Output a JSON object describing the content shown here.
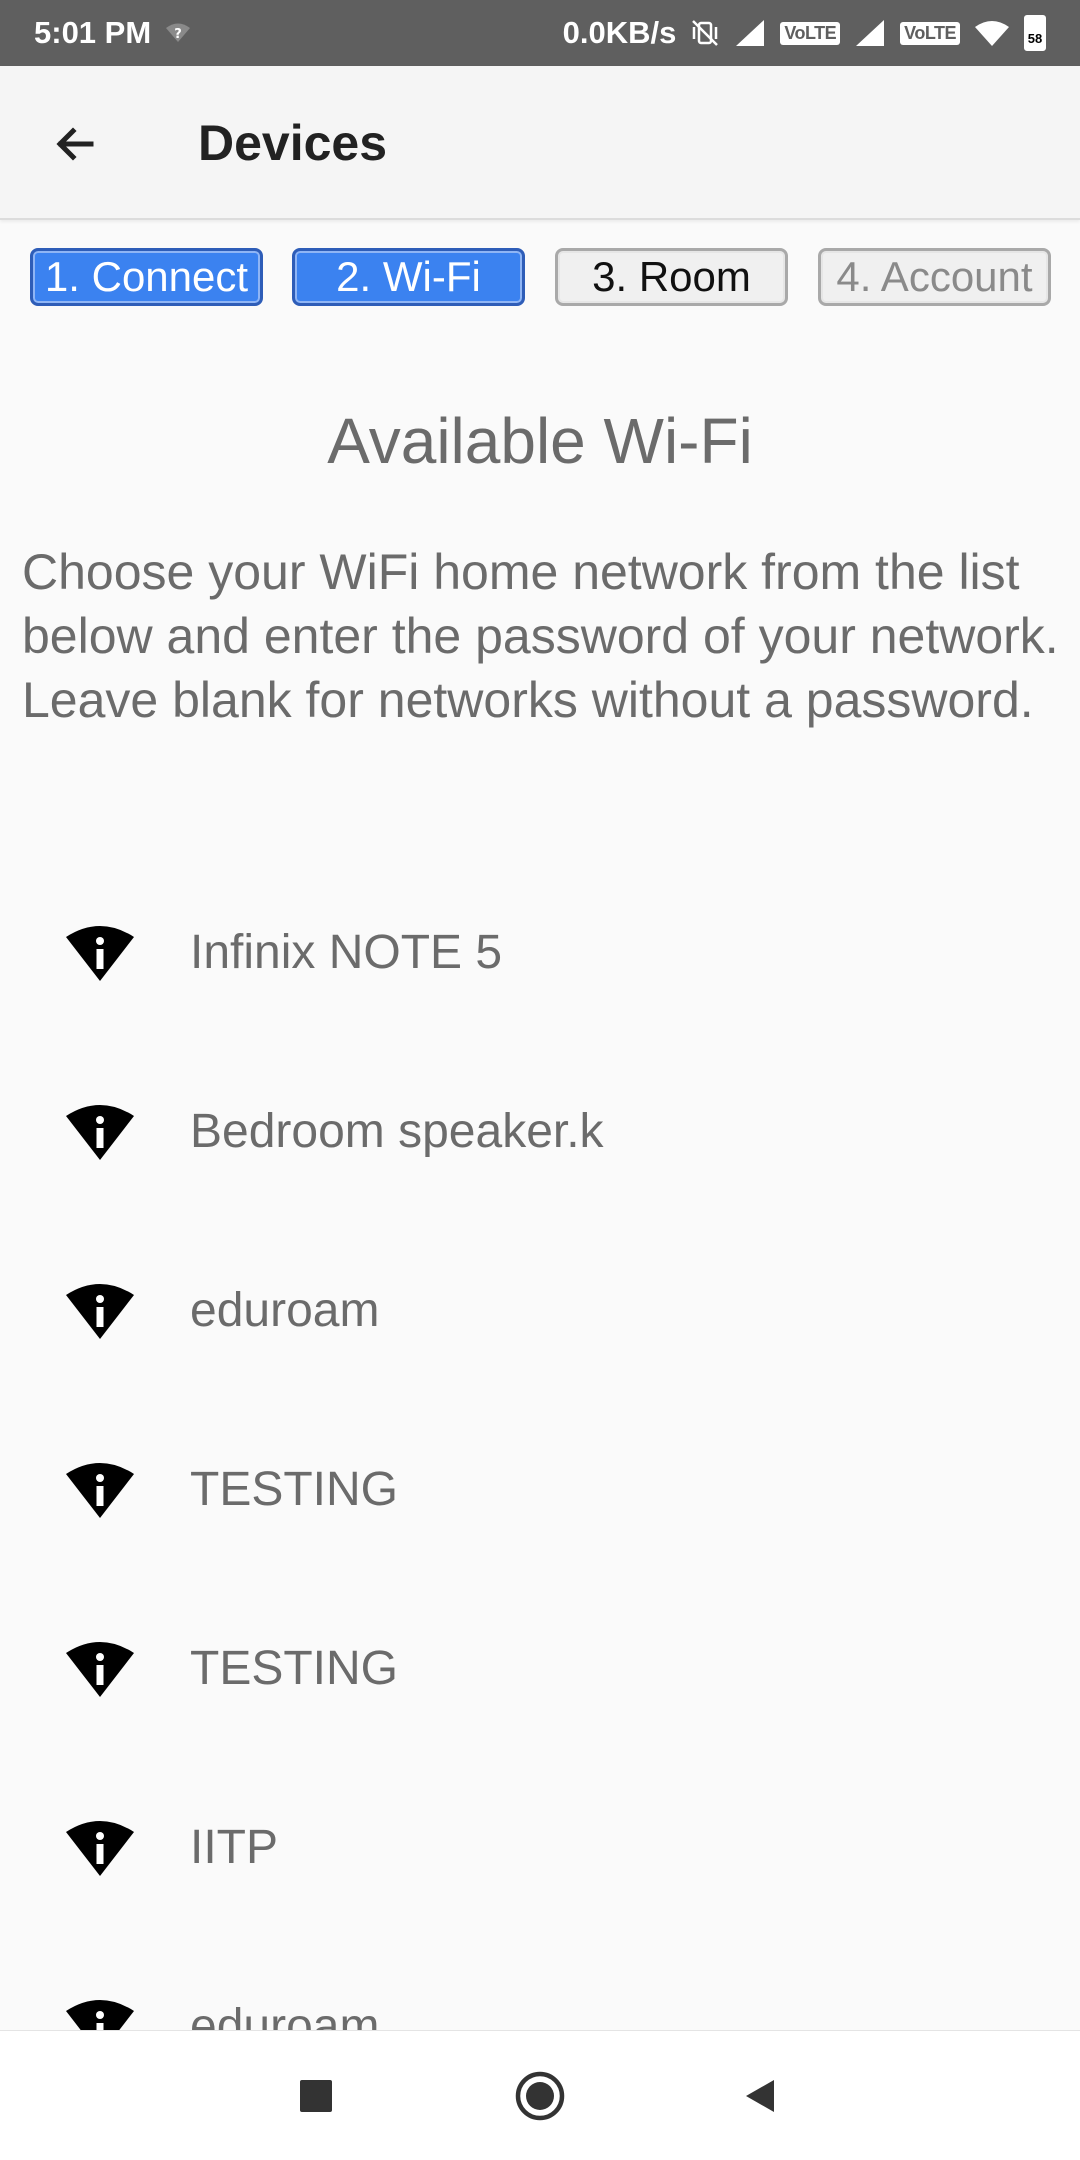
{
  "status_bar": {
    "time": "5:01 PM",
    "net_speed": "0.0KB/s",
    "volte_1": "VoLTE",
    "volte_2": "VoLTE",
    "battery": "58",
    "icons": [
      "wifi-question-icon",
      "vibrate-off-icon",
      "signal-icon",
      "signal-icon",
      "wifi-icon",
      "battery-icon"
    ]
  },
  "app_bar": {
    "title": "Devices",
    "back_icon": "arrow-back-icon"
  },
  "steps": [
    {
      "label": "1. Connect",
      "state": "active"
    },
    {
      "label": "2. Wi-Fi",
      "state": "active"
    },
    {
      "label": "3. Room",
      "state": "inactive"
    },
    {
      "label": "4. Account",
      "state": "disabled"
    }
  ],
  "section_title": "Available Wi-Fi",
  "description": "Choose your WiFi home network from the list below and enter the password of your network. Leave blank for networks without a password.",
  "networks": [
    {
      "name": "Infinix NOTE 5",
      "icon": "wifi-info-icon"
    },
    {
      "name": "Bedroom speaker.k",
      "icon": "wifi-info-icon"
    },
    {
      "name": "eduroam",
      "icon": "wifi-info-icon"
    },
    {
      "name": "TESTING",
      "icon": "wifi-info-icon"
    },
    {
      "name": "TESTING",
      "icon": "wifi-info-icon"
    },
    {
      "name": "IITP",
      "icon": "wifi-info-icon"
    },
    {
      "name": "eduroam",
      "icon": "wifi-info-icon"
    }
  ],
  "nav_bar": {
    "icons": [
      "recents-square-icon",
      "home-circle-icon",
      "back-triangle-icon"
    ]
  },
  "colors": {
    "status_bar": "#5f5f5f",
    "step_active": "#3b82f0",
    "text": "#6b6b6b"
  }
}
